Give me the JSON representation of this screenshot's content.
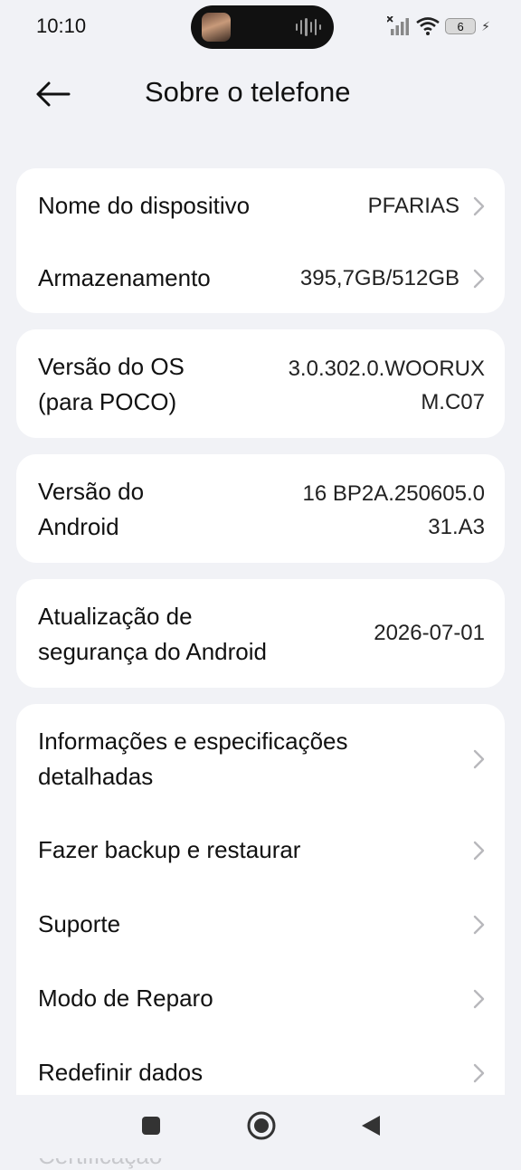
{
  "status_bar": {
    "time": "10:10",
    "battery_level": "6",
    "icons": [
      "signal-off-icon",
      "wifi-icon",
      "battery-icon",
      "charging-icon"
    ]
  },
  "header": {
    "title": "Sobre o telefone"
  },
  "card1": {
    "device_name_label": "Nome do dispositivo",
    "device_name_value": "PFARIAS",
    "storage_label": "Armazenamento",
    "storage_value": "395,7GB/512GB"
  },
  "os": {
    "label_line1": "Versão do OS",
    "label_line2": "(para POCO)",
    "value_line1": "3.0.302.0.WOORUX",
    "value_line2": "M.C07"
  },
  "android": {
    "label_line1": "Versão do",
    "label_line2": "Android",
    "value_line1": "16 BP2A.250605.0",
    "value_line2": "31.A3"
  },
  "security": {
    "label_line1": "Atualização de",
    "label_line2": "segurança do Android",
    "value": "2026-07-01"
  },
  "menu": {
    "info_line1": "Informações e especificações",
    "info_line2": "detalhadas",
    "backup": "Fazer backup e restaurar",
    "support": "Suporte",
    "repair": "Modo de Reparo",
    "reset": "Redefinir dados",
    "next_partial": "Certificação"
  },
  "colors": {
    "background": "#f1f2f6",
    "card": "#ffffff",
    "text": "#111111",
    "chevron": "#b8b8bc"
  }
}
